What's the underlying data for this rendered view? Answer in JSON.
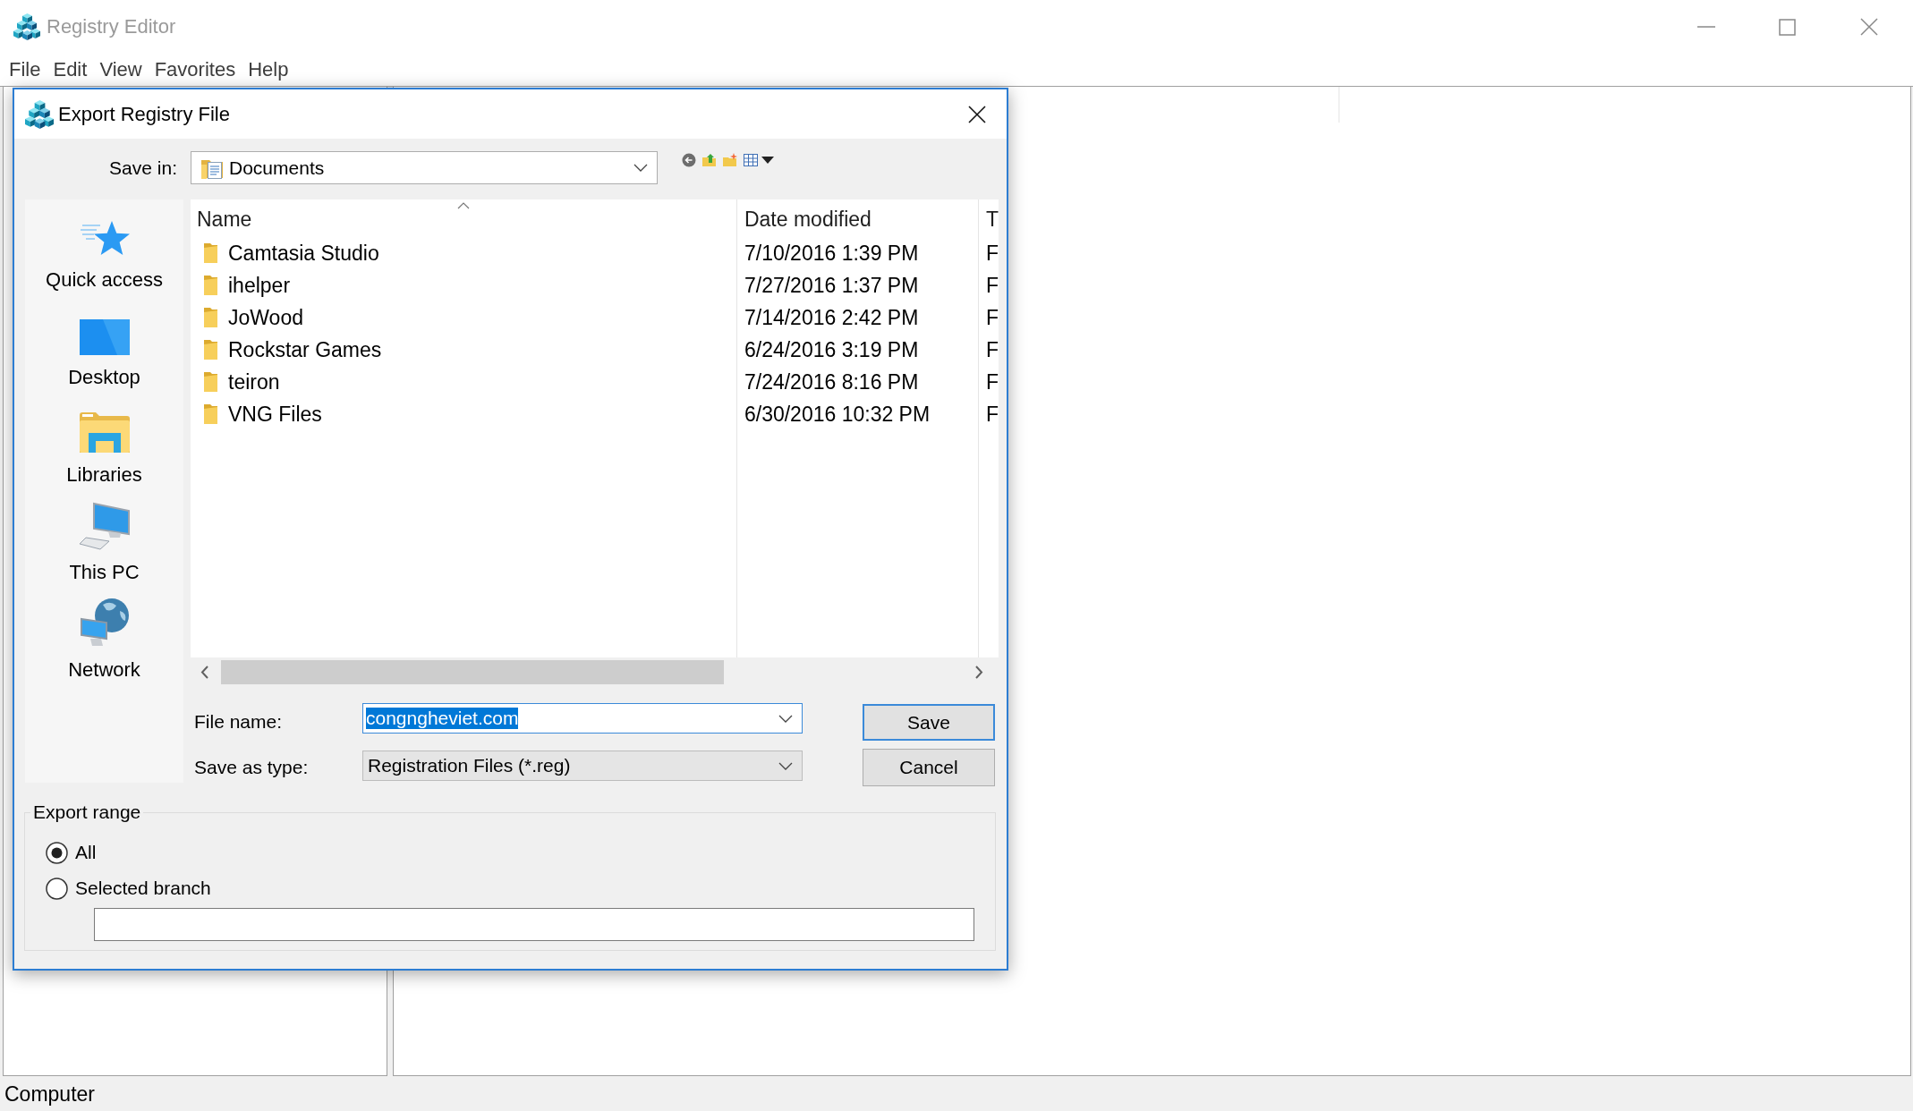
{
  "window": {
    "title": "Registry Editor"
  },
  "menu": [
    {
      "label": "File"
    },
    {
      "label": "Edit"
    },
    {
      "label": "View"
    },
    {
      "label": "Favorites"
    },
    {
      "label": "Help"
    }
  ],
  "dialog": {
    "title": "Export Registry File",
    "save_in": {
      "label": "Save in:",
      "value": "Documents"
    },
    "places": [
      {
        "label": "Quick access",
        "kind": "star"
      },
      {
        "label": "Desktop",
        "kind": "desktop"
      },
      {
        "label": "Libraries",
        "kind": "library"
      },
      {
        "label": "This PC",
        "kind": "computer"
      },
      {
        "label": "Network",
        "kind": "network"
      }
    ],
    "file_list": {
      "columns": [
        {
          "label": "Name",
          "sorted": true
        },
        {
          "label": "Date modified",
          "sorted": false
        },
        {
          "label": "T",
          "sorted": false
        }
      ],
      "rows": [
        {
          "name": "Camtasia Studio",
          "date_modified": "7/10/2016 1:39 PM",
          "column_3": "F",
          "selected": false
        },
        {
          "name": "ihelper",
          "date_modified": "7/27/2016 1:37 PM",
          "column_3": "F",
          "selected": false
        },
        {
          "name": "JoWood",
          "date_modified": "7/14/2016 2:42 PM",
          "column_3": "F",
          "selected": false
        },
        {
          "name": "Rockstar Games",
          "date_modified": "6/24/2016 3:19 PM",
          "column_3": "F",
          "selected": false
        },
        {
          "name": "teiron",
          "date_modified": "7/24/2016 8:16 PM",
          "column_3": "F",
          "selected": false
        },
        {
          "name": "VNG Files",
          "date_modified": "6/30/2016 10:32 PM",
          "column_3": "F",
          "selected": false
        }
      ]
    },
    "file_name": {
      "label": "File name:",
      "value": "congngheviet.com",
      "highlighted": true
    },
    "save_as_type": {
      "label": "Save as type:",
      "value": "Registration Files (*.reg)"
    },
    "buttons": [
      {
        "label": "Save",
        "default": true
      },
      {
        "label": "Cancel",
        "default": false
      }
    ],
    "export_range": {
      "title": "Export range",
      "options": [
        {
          "label": "All",
          "selected": true
        },
        {
          "label": "Selected branch",
          "selected": false
        }
      ]
    }
  },
  "status_bar": {
    "text": "Computer"
  }
}
